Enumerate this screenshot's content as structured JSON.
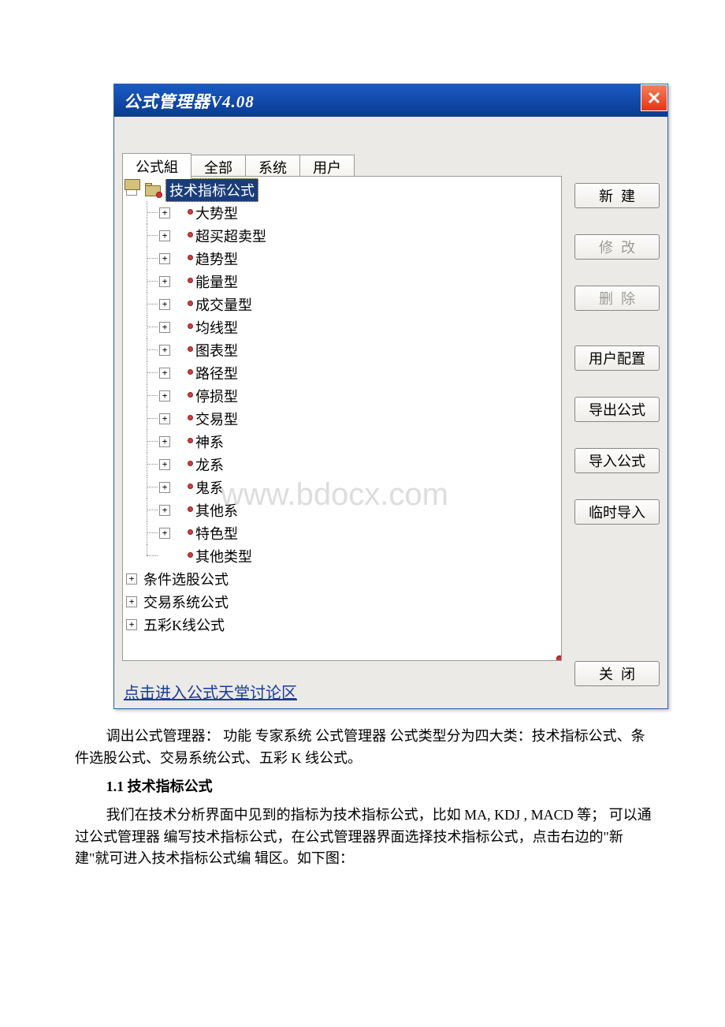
{
  "dialog": {
    "title": "公式管理器V4.08",
    "tabs": {
      "t0": "公式組",
      "t1": "全部",
      "t2": "系统",
      "t3": "用户"
    },
    "tree": {
      "root_label": "技术指标公式",
      "children": [
        "大势型",
        "超买超卖型",
        "趋势型",
        "能量型",
        "成交量型",
        "均线型",
        "图表型",
        "路径型",
        "停损型",
        "交易型",
        "神系",
        "龙系",
        "鬼系",
        "其他系",
        "特色型",
        "其他类型"
      ],
      "siblings": [
        "条件选股公式",
        "交易系统公式",
        "五彩K线公式"
      ]
    },
    "buttons": {
      "new": "新建",
      "modify": "修改",
      "delete": "删除",
      "user_cfg": "用户配置",
      "export": "导出公式",
      "import": "导入公式",
      "temp_import": "临时导入",
      "close": "关闭"
    },
    "footer_link": "点击进入公式天堂讨论区"
  },
  "watermark": "www.bdocx.com",
  "article": {
    "p1": "调出公式管理器： 功能 专家系统 公式管理器 公式类型分为四大类：技术指标公式、条件选股公式、交易系统公式、五彩 K 线公式。",
    "h1": "1.1 技术指标公式",
    "p2": "我们在技术分析界面中见到的指标为技术指标公式，比如 MA, KDJ , MACD 等； 可以通过公式管理器 编写技术指标公式，在公式管理器界面选择技术指标公式，点击右边的\"新建\"就可进入技术指标公式编 辑区。如下图："
  },
  "icons": {
    "minus": "−",
    "plus": "+"
  }
}
